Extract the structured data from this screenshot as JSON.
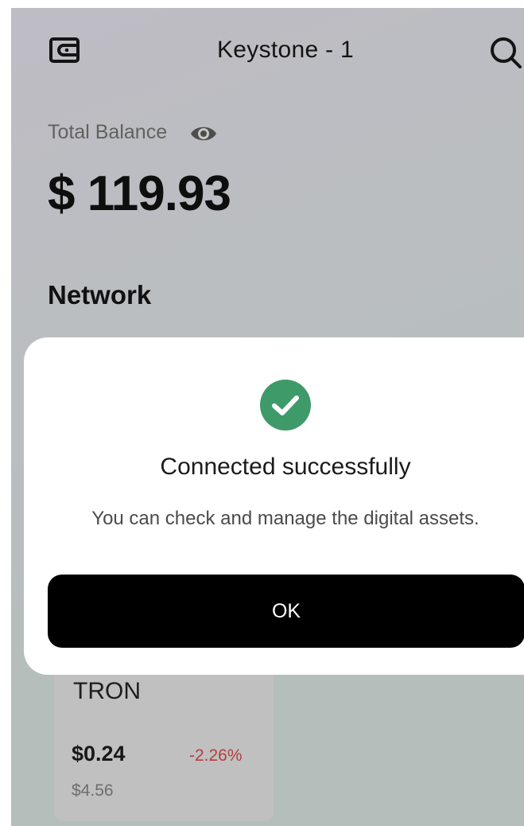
{
  "header": {
    "title": "Keystone - 1",
    "wallet_icon": "wallet-icon",
    "search_icon": "search-icon"
  },
  "balance": {
    "label": "Total Balance",
    "visibility_icon": "eye-icon",
    "value": "$ 119.93"
  },
  "network": {
    "heading": "Network",
    "cards": [
      {
        "name": "TRON",
        "price": "$0.24",
        "change": "-2.26%",
        "holding": "$4.56"
      }
    ]
  },
  "modal": {
    "icon": "check-circle-icon",
    "title": "Connected successfully",
    "message": "You can check and manage the digital assets.",
    "ok_label": "OK"
  },
  "colors": {
    "success": "#3f9a6a",
    "negative": "#e74c4c",
    "primary_button": "#000000"
  }
}
